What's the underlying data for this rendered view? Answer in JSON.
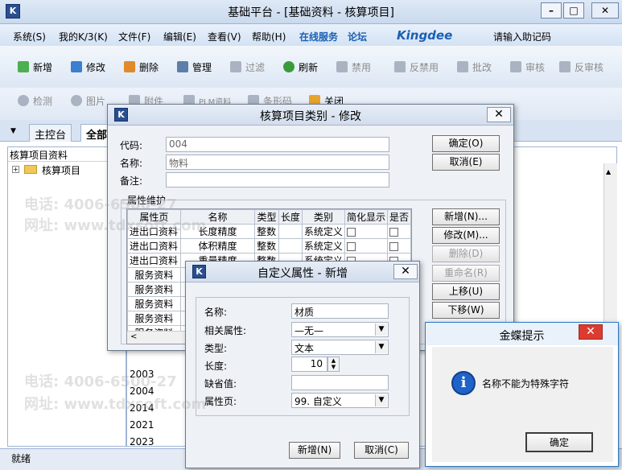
{
  "window": {
    "title": "基础平台 - [基础资料 - 核算项目]",
    "min": "–",
    "max": "□",
    "close": "✕"
  },
  "menu": {
    "items": [
      "系统(S)",
      "我的K/3(K)",
      "文件(F)",
      "编辑(E)",
      "查看(V)",
      "帮助(H)"
    ],
    "online_service": "在线服务",
    "forum": "论坛",
    "brand": "Kingdee",
    "help_placeholder": "请输入助记码"
  },
  "toolbar1": {
    "items": [
      {
        "label": "新增",
        "enabled": true
      },
      {
        "label": "修改",
        "enabled": true
      },
      {
        "label": "删除",
        "enabled": true
      },
      {
        "label": "管理",
        "enabled": true
      },
      {
        "label": "过滤",
        "enabled": false
      },
      {
        "label": "刷新",
        "enabled": true
      },
      {
        "label": "禁用",
        "enabled": false
      },
      {
        "label": "反禁用",
        "enabled": false
      },
      {
        "label": "批改",
        "enabled": false
      },
      {
        "label": "审核",
        "enabled": false
      },
      {
        "label": "反审核",
        "enabled": false
      }
    ]
  },
  "toolbar2": {
    "items": [
      {
        "label": "检测",
        "enabled": false
      },
      {
        "label": "图片",
        "enabled": false
      },
      {
        "label": "附件",
        "enabled": false
      },
      {
        "label": "PLM资料",
        "enabled": false
      },
      {
        "label": "条形码",
        "enabled": false
      },
      {
        "label": "关闭",
        "enabled": true
      }
    ]
  },
  "tabs": [
    "主控台",
    "全部"
  ],
  "left_pane": {
    "header": "核算项目资料",
    "tree_root": "核算项目",
    "expand": "+"
  },
  "years": [
    "2003",
    "2004",
    "2014",
    "2021",
    "2023"
  ],
  "status": "就绪",
  "dialog_category": {
    "title": "核算项目类别 - 修改",
    "code_label": "代码:",
    "code_value": "004",
    "name_label": "名称:",
    "name_value": "物料",
    "remark_label": "备注:",
    "remark_value": "",
    "ok": "确定(O)",
    "cancel": "取消(E)",
    "section": "属性维护",
    "columns": [
      "属性页",
      "名称",
      "类型",
      "长度",
      "类别",
      "简化显示",
      "是否"
    ],
    "rows": [
      [
        "进出口资料",
        "长度精度",
        "整数",
        "",
        "系统定义"
      ],
      [
        "进出口资料",
        "体积精度",
        "整数",
        "",
        "系统定义"
      ],
      [
        "进出口资料",
        "重量精度",
        "整数",
        "",
        "系统定义"
      ],
      [
        "服务资料",
        "",
        "",
        "",
        ""
      ],
      [
        "服务资料",
        "",
        "",
        "",
        ""
      ],
      [
        "服务资料",
        "",
        "",
        "",
        ""
      ],
      [
        "服务资料",
        "",
        "",
        "",
        ""
      ],
      [
        "服务资料",
        "",
        "",
        "",
        ""
      ]
    ],
    "side_buttons": [
      {
        "label": "新增(N)...",
        "enabled": true
      },
      {
        "label": "修改(M)...",
        "enabled": true
      },
      {
        "label": "删除(D)",
        "enabled": false
      },
      {
        "label": "重命名(R)",
        "enabled": false
      },
      {
        "label": "上移(U)",
        "enabled": true
      },
      {
        "label": "下移(W)",
        "enabled": true
      }
    ]
  },
  "dialog_custom": {
    "title": "自定义属性 - 新增",
    "name_label": "名称:",
    "name_value": "材质",
    "related_label": "相关属性:",
    "related_value": "—无—",
    "type_label": "类型:",
    "type_value": "文本",
    "length_label": "长度:",
    "length_value": "10",
    "default_label": "缺省值:",
    "default_value": "",
    "page_label": "属性页:",
    "page_value": "99. 自定义",
    "add": "新增(N)",
    "cancel": "取消(C)"
  },
  "alert": {
    "title": "金蝶提示",
    "message": "名称不能为特殊字符",
    "ok": "确定"
  },
  "watermark": {
    "phone": "电话: 4006-6500-27",
    "site": "网址: www.tdxsoft.com"
  },
  "colors": {
    "accent": "#2a4f8e",
    "brand_blue": "#1b5fb3",
    "info_blue": "#1e63c8"
  }
}
